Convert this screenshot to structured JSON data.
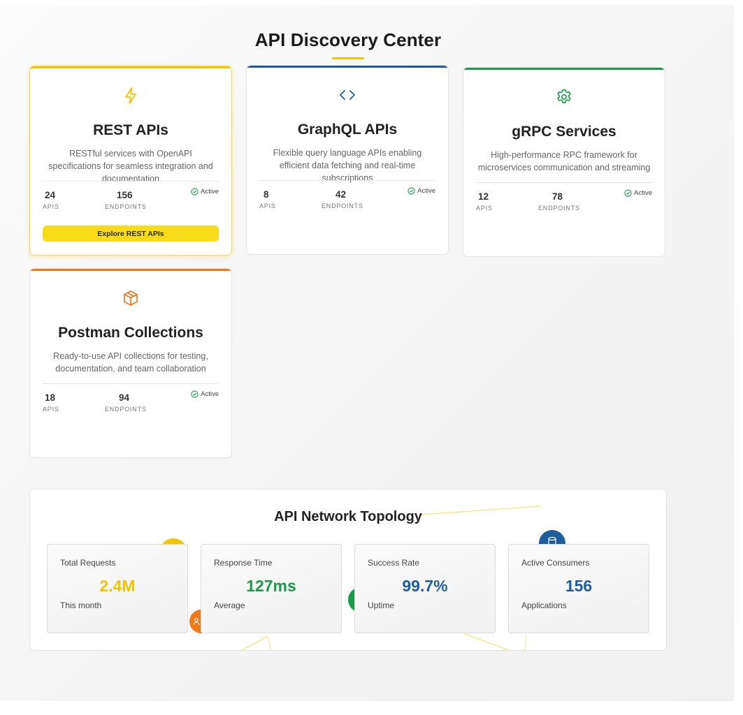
{
  "page": {
    "title": "API Discovery Center"
  },
  "colors": {
    "yellow": "#f5c400",
    "blue": "#1f5e9e",
    "green": "#1a9a4a",
    "orange": "#f07a1a"
  },
  "cards": [
    {
      "icon": "lightning-icon",
      "title": "REST APIs",
      "description": "RESTful services with OpenAPI specifications for seamless integration and documentation",
      "apis_value": "24",
      "apis_label": "APIS",
      "endpoints_value": "156",
      "endpoints_label": "ENDPOINTS",
      "status": "Active",
      "button_label": "Explore REST APIs",
      "accent": "#f5c400"
    },
    {
      "icon": "code-brackets-icon",
      "title": "GraphQL APIs",
      "description": "Flexible query language APIs enabling efficient data fetching and real-time subscriptions",
      "apis_value": "8",
      "apis_label": "APIS",
      "endpoints_value": "42",
      "endpoints_label": "ENDPOINTS",
      "status": "Active",
      "accent": "#1f5e9e"
    },
    {
      "icon": "gear-icon",
      "title": "gRPC Services",
      "description": "High-performance RPC framework for microservices communication and streaming",
      "apis_value": "12",
      "apis_label": "APIS",
      "endpoints_value": "78",
      "endpoints_label": "ENDPOINTS",
      "status": "Active",
      "accent": "#1a9a4a"
    },
    {
      "icon": "package-icon",
      "title": "Postman Collections",
      "description": "Ready-to-use API collections for testing, documentation, and team collaboration",
      "apis_value": "18",
      "apis_label": "APIS",
      "endpoints_value": "94",
      "endpoints_label": "ENDPOINTS",
      "status": "Active",
      "accent": "#f07a1a"
    }
  ],
  "topology": {
    "title": "API Network Topology",
    "metrics": [
      {
        "label": "Total Requests",
        "value": "2.4M",
        "sub": "This month",
        "color": "#f5c400"
      },
      {
        "label": "Response Time",
        "value": "127ms",
        "sub": "Average",
        "color": "#1a9a4a"
      },
      {
        "label": "Success Rate",
        "value": "99.7%",
        "sub": "Uptime",
        "color": "#1f5e9e"
      },
      {
        "label": "Active Consumers",
        "value": "156",
        "sub": "Applications",
        "color": "#1f5e9e"
      }
    ]
  }
}
